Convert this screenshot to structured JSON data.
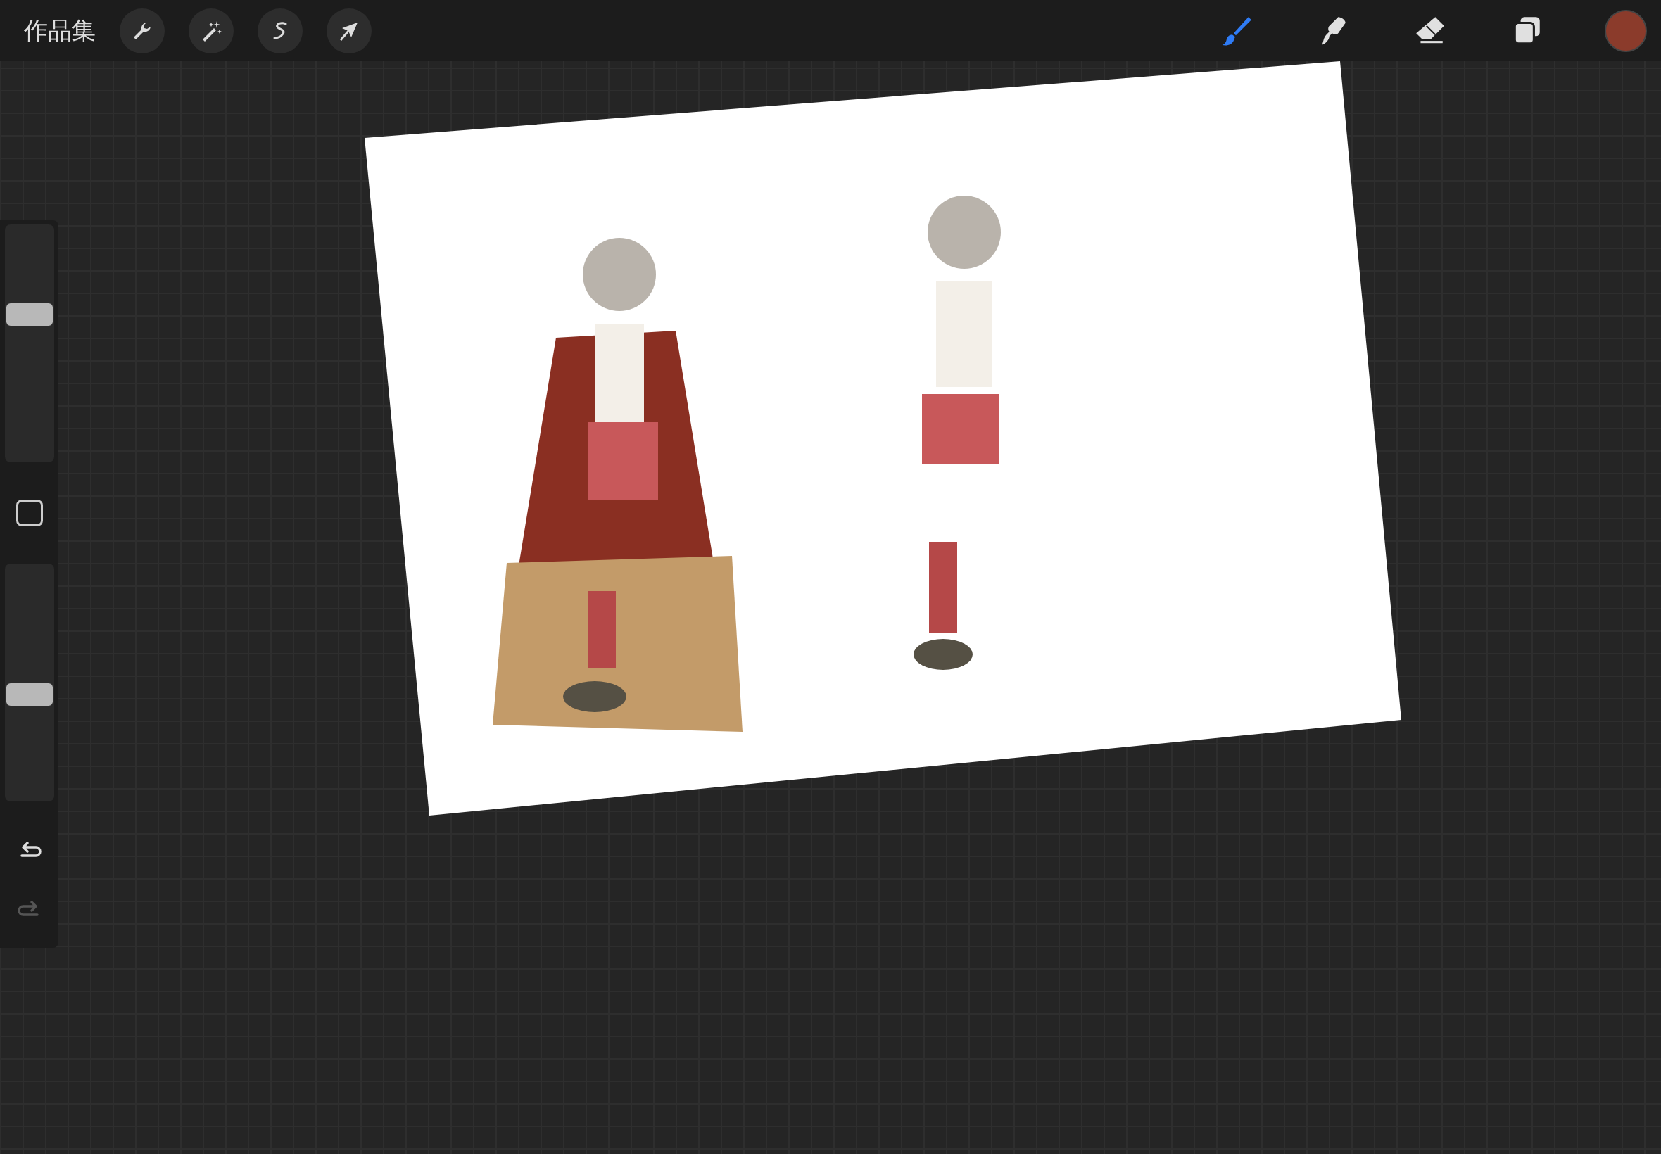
{
  "top_bar": {
    "gallery_label": "作品集",
    "actions": [
      {
        "kind": "wrench"
      },
      {
        "kind": "wand"
      },
      {
        "kind": "selection"
      },
      {
        "kind": "transform"
      }
    ],
    "tools": [
      {
        "kind": "brush",
        "selected": true
      },
      {
        "kind": "smudge",
        "selected": false
      },
      {
        "kind": "eraser",
        "selected": false
      },
      {
        "kind": "layers",
        "selected": false
      }
    ],
    "color": "#8b3b2b"
  },
  "sidebar": {
    "brush_size": {
      "level": 0.62
    },
    "opacity": {
      "level": 0.45
    },
    "undo": {
      "disabled": false
    },
    "redo": {
      "disabled": true
    }
  }
}
